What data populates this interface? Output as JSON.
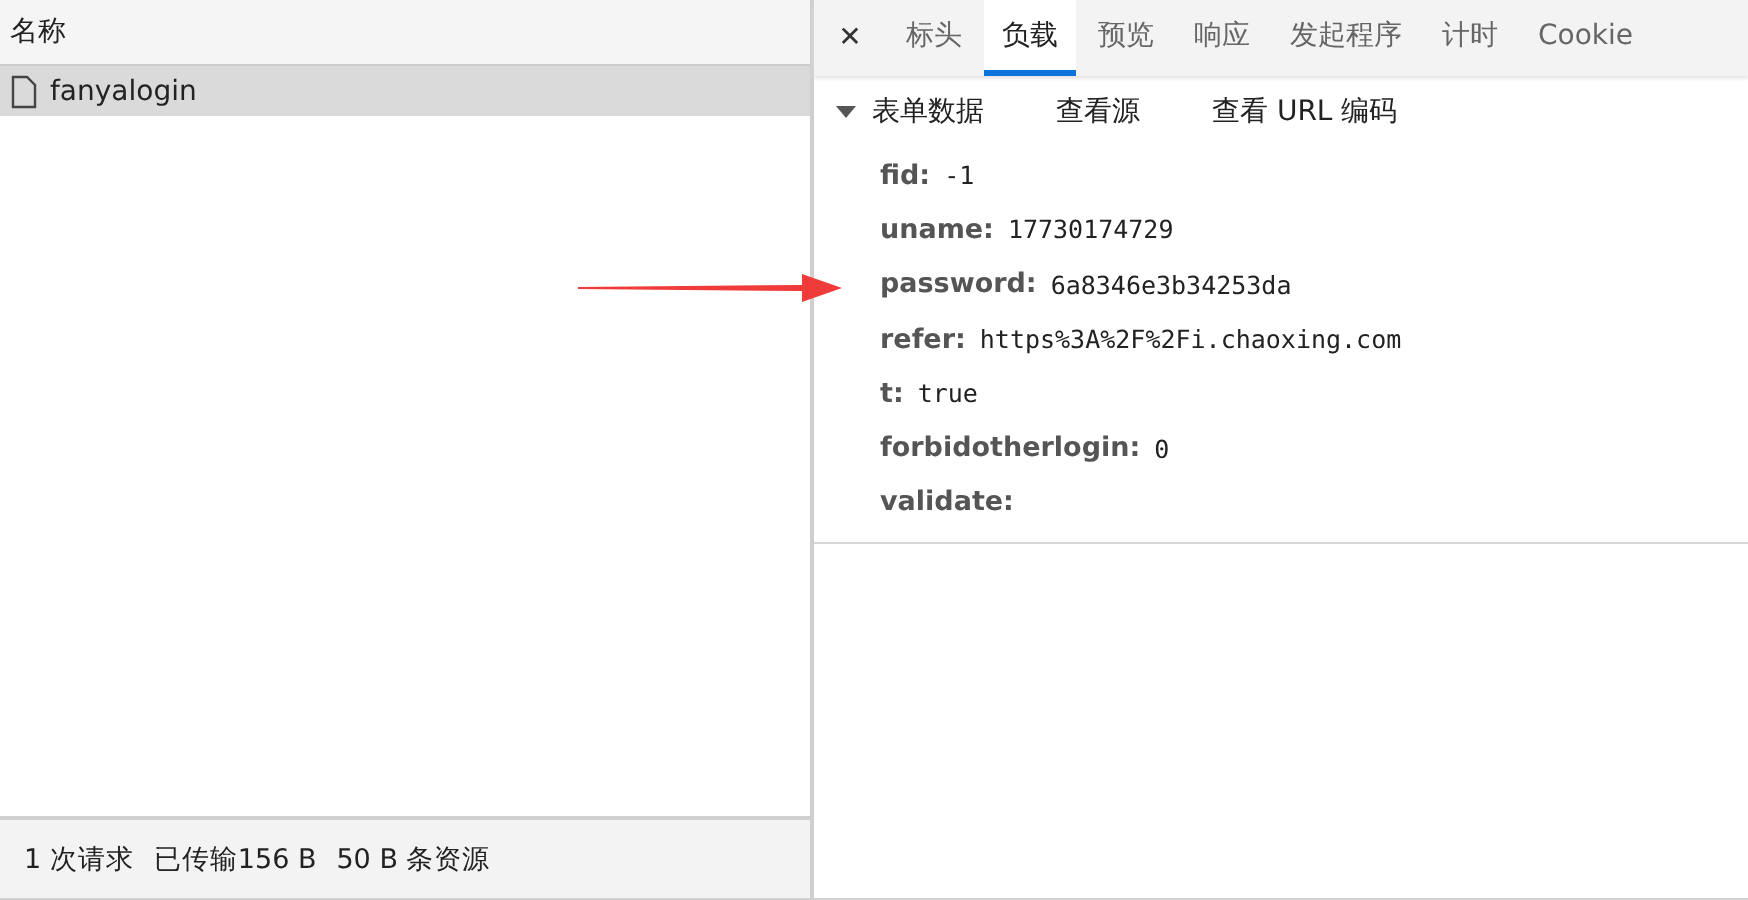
{
  "request_list": {
    "column_header": "名称",
    "rows": [
      {
        "name": "fanyalogin",
        "selected": true
      }
    ]
  },
  "status_bar": [
    "1 次请求",
    "已传输156 B",
    "50 B 条资源"
  ],
  "tabs": [
    {
      "label": "标头",
      "selected": false
    },
    {
      "label": "负载",
      "selected": true
    },
    {
      "label": "预览",
      "selected": false
    },
    {
      "label": "响应",
      "selected": false
    },
    {
      "label": "发起程序",
      "selected": false
    },
    {
      "label": "计时",
      "selected": false
    },
    {
      "label": "Cookie",
      "selected": false
    }
  ],
  "close_button": "✕",
  "form_section": {
    "title": "表单数据",
    "expanded": true,
    "actions": [
      "查看源",
      "查看 URL 编码"
    ],
    "fields": [
      {
        "key": "fid:",
        "value": "-1"
      },
      {
        "key": "uname:",
        "value": "17730174729"
      },
      {
        "key": "password:",
        "value": "6a8346e3b34253da"
      },
      {
        "key": "refer:",
        "value": "https%3A%2F%2Fi.chaoxing.com"
      },
      {
        "key": "t:",
        "value": "true"
      },
      {
        "key": "forbidotherlogin:",
        "value": "0"
      },
      {
        "key": "validate:"
      }
    ]
  }
}
